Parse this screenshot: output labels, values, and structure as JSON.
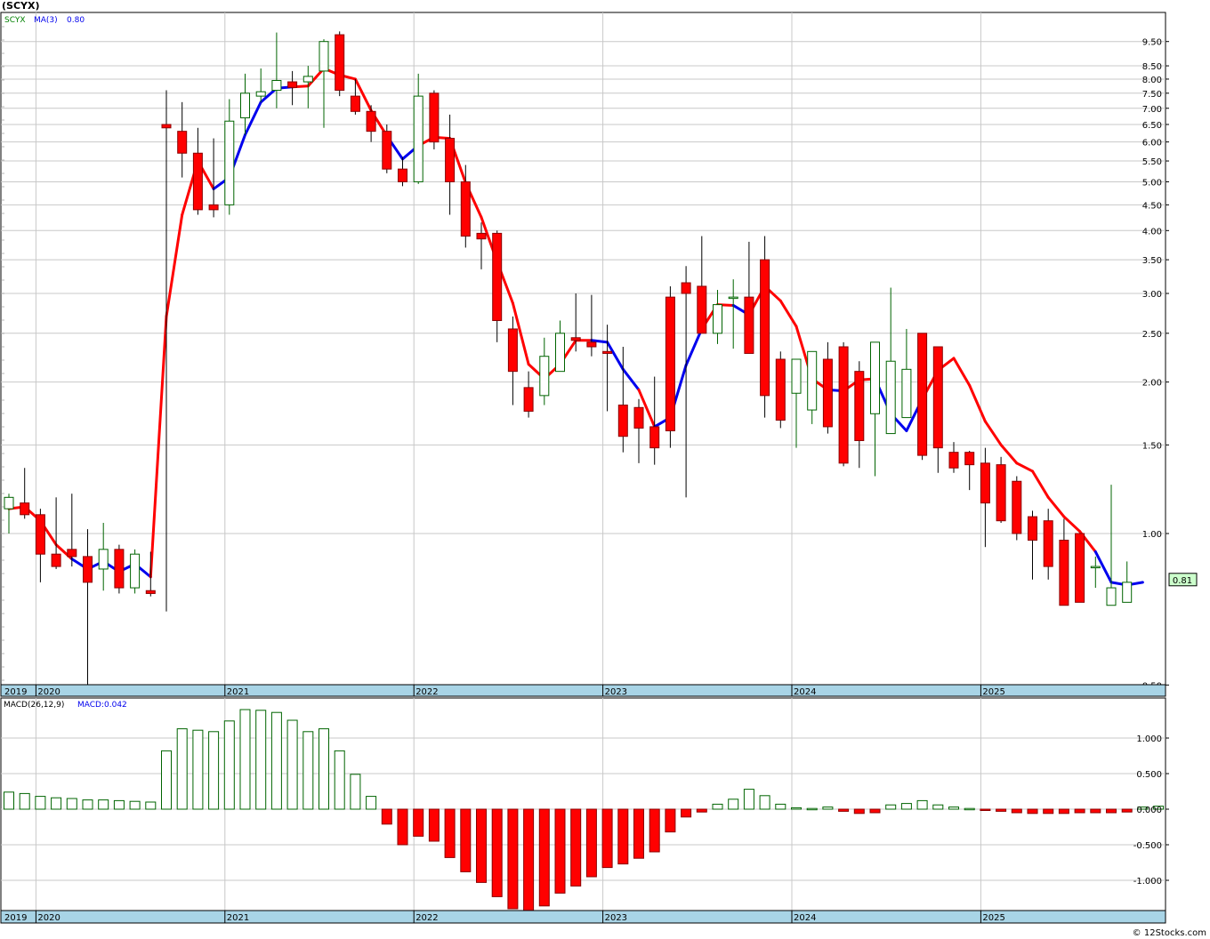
{
  "title": "(SCYX)",
  "credit": "© 12Stocks.com",
  "colors": {
    "up_candle_fill": "#ffffff",
    "up_candle_stroke": "#006400",
    "down_candle_fill": "#ff0000",
    "down_candle_stroke": "#8b0000",
    "ma_up": "#0000ee",
    "ma_down": "#ff0000",
    "macd_pos_stroke": "#006400",
    "macd_neg_fill": "#ff0000",
    "axis_band": "#a8d4e6",
    "grid": "#c8c8c8",
    "last_price_box": "#ccffcc"
  },
  "chart_data": [
    {
      "type": "candlestick",
      "title": "(SCYX)",
      "legend": {
        "symbol": "SCYX",
        "ma_label": "MA(3)",
        "ma_value": "0.80"
      },
      "scale": "log",
      "ylim": [
        0.5,
        10.2
      ],
      "y_ticks": [
        "9.50",
        "8.50",
        "8.00",
        "7.50",
        "7.00",
        "6.50",
        "6.00",
        "5.50",
        "5.00",
        "4.50",
        "4.00",
        "3.50",
        "3.00",
        "2.50",
        "2.00",
        "1.50",
        "1.00",
        "0.50"
      ],
      "x_labels": [
        "2019",
        "2020",
        "2021",
        "2022",
        "2023",
        "2024",
        "2025"
      ],
      "last_price_label": "0.81",
      "periods": [
        "2019-11",
        "2019-12",
        "2020-01",
        "2020-02",
        "2020-03",
        "2020-04",
        "2020-05",
        "2020-06",
        "2020-07",
        "2020-08",
        "2020-09",
        "2020-10",
        "2020-11",
        "2020-12",
        "2021-01",
        "2021-02",
        "2021-03",
        "2021-04",
        "2021-05",
        "2021-06",
        "2021-07",
        "2021-08",
        "2021-09",
        "2021-10",
        "2021-11",
        "2021-12",
        "2022-01",
        "2022-02",
        "2022-03",
        "2022-04",
        "2022-05",
        "2022-06",
        "2022-07",
        "2022-08",
        "2022-09",
        "2022-10",
        "2022-11",
        "2022-12",
        "2023-01",
        "2023-02",
        "2023-03",
        "2023-04",
        "2023-05",
        "2023-06",
        "2023-07",
        "2023-08",
        "2023-09",
        "2023-10",
        "2023-11",
        "2023-12",
        "2024-01",
        "2024-02",
        "2024-03",
        "2024-04",
        "2024-05",
        "2024-06",
        "2024-07",
        "2024-08",
        "2024-09",
        "2024-10",
        "2024-11",
        "2024-12",
        "2025-01",
        "2025-02",
        "2025-03",
        "2025-04",
        "2025-05",
        "2025-06",
        "2025-07",
        "2025-08",
        "2025-09",
        "2025-10",
        "2025-11"
      ],
      "open": [
        1.12,
        1.15,
        1.09,
        0.91,
        0.93,
        0.9,
        0.85,
        0.93,
        0.78,
        0.77,
        6.5,
        6.3,
        5.7,
        4.5,
        4.5,
        6.7,
        7.4,
        7.6,
        7.9,
        7.9,
        8.3,
        9.8,
        7.4,
        6.9,
        6.3,
        5.3,
        5.0,
        7.5,
        6.1,
        5.0,
        3.95,
        3.95,
        2.55,
        1.95,
        1.88,
        2.1,
        2.45,
        2.4,
        2.3,
        1.8,
        1.78,
        1.63,
        2.95,
        3.15,
        3.1,
        2.5,
        2.95,
        2.95,
        3.5,
        2.22,
        1.9,
        1.76,
        2.22,
        2.35,
        2.1,
        1.73,
        1.58,
        1.7,
        2.5,
        2.35,
        1.45,
        1.45,
        1.38,
        1.37,
        1.27,
        1.08,
        1.06,
        0.97,
        1.0,
        0.86,
        0.72,
        0.73,
        0.83,
        0.79
      ],
      "close": [
        1.18,
        1.09,
        0.91,
        0.86,
        0.9,
        0.8,
        0.93,
        0.78,
        0.91,
        0.76,
        6.4,
        5.7,
        4.4,
        4.4,
        6.6,
        7.5,
        7.55,
        7.95,
        7.7,
        8.1,
        9.5,
        7.6,
        6.9,
        6.3,
        5.3,
        5.0,
        7.4,
        6.0,
        5.0,
        3.9,
        3.85,
        2.65,
        2.1,
        1.75,
        2.25,
        2.5,
        2.42,
        2.35,
        2.28,
        1.56,
        1.62,
        1.48,
        1.6,
        3.0,
        2.5,
        2.85,
        2.95,
        2.28,
        1.88,
        1.68,
        2.22,
        2.3,
        1.63,
        1.38,
        1.53,
        2.4,
        2.2,
        2.12,
        1.43,
        1.48,
        1.35,
        1.37,
        1.15,
        1.06,
        1.0,
        0.97,
        0.86,
        0.72,
        0.73,
        0.86,
        0.78,
        0.8
      ],
      "high": [
        1.2,
        1.35,
        1.12,
        1.18,
        1.2,
        1.02,
        1.05,
        0.95,
        0.93,
        0.92,
        7.6,
        7.2,
        6.4,
        6.1,
        7.3,
        8.2,
        8.4,
        9.9,
        8.3,
        8.5,
        9.6,
        9.95,
        8.0,
        7.1,
        6.5,
        5.6,
        8.2,
        7.6,
        6.8,
        5.4,
        4.15,
        4.0,
        2.7,
        2.1,
        2.45,
        2.65,
        3.0,
        2.98,
        2.6,
        2.35,
        1.85,
        2.05,
        3.1,
        3.4,
        3.9,
        3.05,
        3.2,
        3.8,
        3.9,
        2.3,
        2.05,
        2.25,
        2.4,
        2.4,
        2.2,
        1.95,
        3.08,
        2.55,
        2.45,
        1.6,
        1.52,
        1.46,
        1.48,
        1.42,
        1.3,
        1.11,
        1.12,
        1.07,
        0.95,
        0.9,
        1.25,
        0.88
      ],
      "low": [
        1.0,
        1.07,
        0.8,
        0.85,
        0.86,
        0.5,
        0.77,
        0.76,
        0.76,
        0.75,
        0.7,
        5.1,
        4.3,
        4.25,
        4.3,
        6.2,
        7.2,
        7.0,
        7.1,
        7.0,
        6.4,
        7.4,
        6.8,
        6.0,
        5.2,
        4.9,
        4.95,
        5.8,
        4.3,
        3.7,
        3.35,
        2.4,
        1.8,
        1.7,
        1.8,
        2.2,
        2.3,
        2.25,
        1.75,
        1.45,
        1.38,
        1.37,
        1.48,
        1.18,
        2.5,
        2.38,
        2.33,
        2.35,
        1.7,
        1.62,
        1.48,
        1.65,
        1.58,
        1.36,
        1.35,
        1.3,
        1.6,
        1.7,
        1.4,
        1.32,
        1.32,
        1.22,
        0.94,
        1.05,
        0.97,
        0.81,
        0.81,
        0.74,
        0.73,
        0.78,
        0.77,
        0.78
      ],
      "ma3": [
        1.12,
        1.13,
        1.06,
        0.95,
        0.89,
        0.85,
        0.88,
        0.84,
        0.87,
        0.82,
        2.7,
        4.3,
        5.5,
        4.84,
        5.1,
        6.2,
        7.2,
        7.67,
        7.72,
        7.75,
        8.4,
        8.15,
        8.0,
        6.93,
        6.17,
        5.55,
        5.9,
        6.13,
        6.1,
        4.98,
        4.25,
        3.47,
        2.87,
        2.17,
        2.03,
        2.17,
        2.42,
        2.42,
        2.4,
        2.12,
        1.93,
        1.63,
        1.7,
        2.16,
        2.55,
        2.85,
        2.84,
        2.72,
        3.1,
        2.9,
        2.58,
        2.03,
        1.93,
        1.92,
        2.02,
        2.03,
        1.73,
        1.6,
        1.85,
        2.11,
        2.23,
        1.97,
        1.67,
        1.5,
        1.38,
        1.33,
        1.18,
        1.08,
        1.01,
        0.92,
        0.8,
        0.79,
        0.8
      ],
      "ma3_blue_segments": [
        [
          4,
          9
        ],
        [
          13,
          18
        ],
        [
          24,
          26
        ],
        [
          37,
          40
        ],
        [
          41,
          44
        ],
        [
          46,
          47
        ],
        [
          52,
          53
        ],
        [
          55,
          58
        ],
        [
          69,
          72
        ]
      ]
    },
    {
      "type": "bar",
      "title": "MACD(26,12,9)",
      "legend": {
        "label": "MACD(26,12,9)",
        "value_label": "MACD:0.042"
      },
      "ylim": [
        -1.45,
        1.45
      ],
      "y_ticks": [
        "1.000",
        "0.500",
        "0.000",
        "-0.500",
        "-1.000"
      ],
      "x_labels": [
        "2019",
        "2020",
        "2021",
        "2022",
        "2023",
        "2024",
        "2025"
      ],
      "values": [
        0.24,
        0.22,
        0.18,
        0.16,
        0.15,
        0.13,
        0.13,
        0.12,
        0.11,
        0.1,
        0.82,
        1.13,
        1.11,
        1.09,
        1.24,
        1.4,
        1.39,
        1.36,
        1.25,
        1.09,
        1.13,
        0.82,
        0.49,
        0.18,
        -0.21,
        -0.5,
        -0.38,
        -0.45,
        -0.68,
        -0.88,
        -1.03,
        -1.23,
        -1.4,
        -1.45,
        -1.36,
        -1.18,
        -1.08,
        -0.95,
        -0.82,
        -0.77,
        -0.69,
        -0.6,
        -0.32,
        -0.11,
        -0.04,
        0.07,
        0.14,
        0.28,
        0.19,
        0.07,
        0.02,
        0.01,
        0.03,
        -0.03,
        -0.06,
        -0.05,
        0.06,
        0.08,
        0.12,
        0.06,
        0.03,
        0.01,
        -0.01,
        -0.03,
        -0.05,
        -0.06,
        -0.06,
        -0.06,
        -0.05,
        -0.05,
        -0.05,
        -0.04,
        0.03,
        0.042
      ]
    }
  ]
}
